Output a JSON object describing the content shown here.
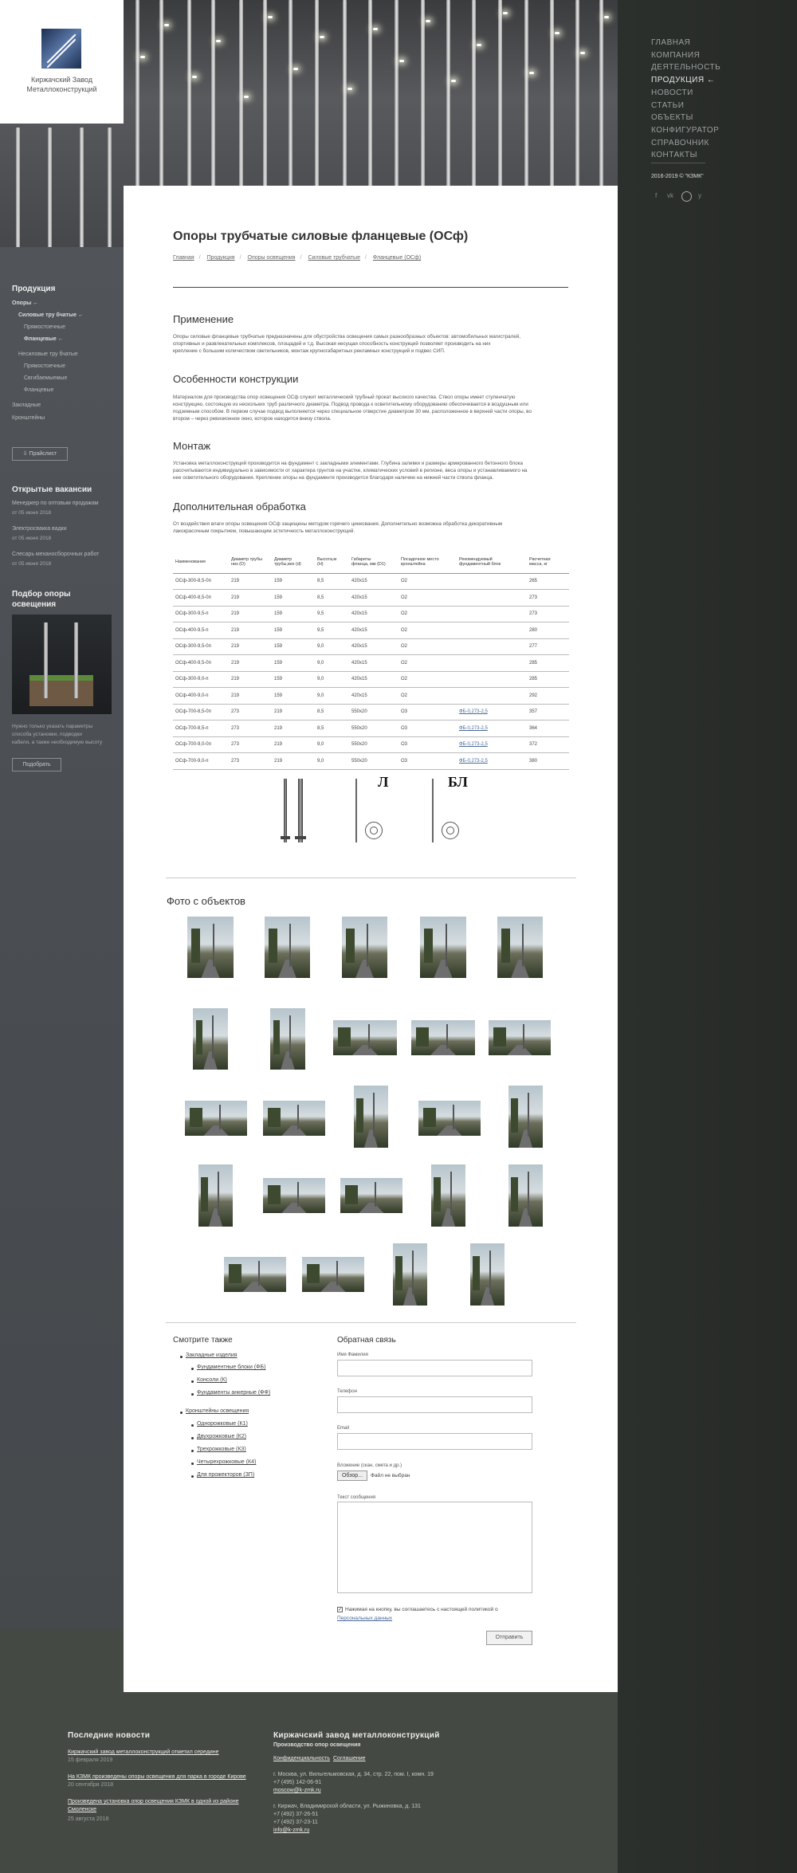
{
  "logo": {
    "line1": "Киржачский Завод",
    "line2": "Металлоконструкций"
  },
  "right_nav": {
    "items": [
      "ГЛАВНАЯ",
      "КОМПАНИЯ",
      "ДЕЯТЕЛЬНОСТЬ",
      "ПРОДУКЦИЯ ←",
      "НОВОСТИ",
      "СТАТЬИ",
      "ОБЪЕКТЫ",
      "КОНФИГУРАТОР",
      "СПРАВОЧНИК",
      "КОНТАКТЫ"
    ],
    "copyright": "2016-2019 © \"КЗМК\"",
    "social": [
      "f",
      "vk",
      "y"
    ]
  },
  "left_nav": {
    "heading": "Продукция",
    "items": [
      "Опоры  ←",
      "Силовые тру бчатые  ←",
      "Прямостоечные",
      "Фланцевые  ←",
      "Несиловые тру бчатые",
      "Прямостоечные",
      "Свгибаемыемые",
      "Фланцевые",
      "Закладные",
      "Кронштейны"
    ],
    "price_btn": "⇩ Прайслист"
  },
  "vacancies": {
    "heading": "Открытые вакансии",
    "items": [
      {
        "title": "Менеджер по оптовым продажам",
        "date": "от 05 июня 2018"
      },
      {
        "title": "Электросвакка вадки",
        "date": "от 05 июня 2018"
      },
      {
        "title": "Слесарь механосборочных работ",
        "date": "от 05 июня 2018"
      }
    ]
  },
  "picker": {
    "heading1": "Подбор опоры",
    "heading2": "освещения",
    "text": [
      "Нужно только указать параметры",
      "способа установки, подводки",
      "кабеля, а также необходимую высоту"
    ],
    "button": "Подобрать"
  },
  "main": {
    "title": "Опоры трубчатые силовые фланцевые (ОСф)",
    "breadcrumbs": [
      "Главная",
      "Продукция",
      "Опоры освещения",
      "Силовые трубчатые",
      "Фланцевые (ОСф)"
    ],
    "sections": [
      {
        "title": "Применение",
        "text": [
          "Опоры силовые фланцевые трубчатые предназначены для обустройства освещения самых разнообразных объектов: автомобильных магистралей,",
          "спортивных и развлекательных комплексов, площадей и т.д. Высокая несущая способность конструкций позволяет производить на них",
          "крепление с большим количеством светильников, монтаж крупногабаритных рекламных конструкций и подвес СИП."
        ]
      },
      {
        "title": "Особенности конструкции",
        "text": [
          "Материалом для производства опор освещения ОСф служит металлический трубный прокат высокого качества. Ствол опоры имеет ступенчатую",
          "конструкцию, состоящую из нескольких труб различного диаметра. Подвод провода к осветительному оборудованию обеспечивается в воздушным или",
          "подземным способом. В первом случае подвод выполняется через специальное отверстие диаметром 30 мм, расположенное в верхней части опоры, во",
          "втором – через ревизионное окно, которое находится внизу ствола."
        ]
      },
      {
        "title": "Монтаж",
        "text": [
          "Установка металлоконструкций производится на фундамент с закладными элементами. Глубина заливки и размеры армированного бетонного блока",
          "рассчитываются индивидуально в зависимости от характера грунтов на участке, климатических условий в регионе, веса опоры и устанавливаемого на",
          "нее осветительного оборудования. Крепление опоры на фундаменте производится благодаря наличию на нижней части ствола фланца."
        ]
      },
      {
        "title": "Дополнительная обработка",
        "text": [
          "От воздействия влаги опоры освещения ОСф защищены методом горячего цинкования. Дополнительно возможна обработка декоративным",
          "лакокрасочным покрытием, повышающим эстетичность металлоконструкций."
        ]
      }
    ],
    "table": {
      "headers": [
        [
          "Наименование"
        ],
        [
          "Диаметр трубы",
          "низ (D)"
        ],
        [
          "Диаметр",
          "трубы,вех (d)"
        ],
        [
          "Высота,м",
          "(H)"
        ],
        [
          "Габариты",
          "фланца, мм (D1)"
        ],
        [
          "Посадочное место",
          "кронштейна"
        ],
        [
          "Рекомендуемый",
          "фундаментный блок"
        ],
        [
          "Расчетная",
          "масса, кг"
        ]
      ],
      "rows": [
        [
          "ОСф-300-8,5-0п",
          "219",
          "159",
          "8,5",
          "420х15",
          "О2",
          "",
          "265"
        ],
        [
          "ОСф-400-8,5-0п",
          "219",
          "159",
          "8,5",
          "420х15",
          "О2",
          "",
          "273"
        ],
        [
          "ОСф-300-9,5-п",
          "219",
          "159",
          "9,5",
          "420х15",
          "О2",
          "",
          "273"
        ],
        [
          "ОСф-400-9,5-п",
          "219",
          "159",
          "9,5",
          "420х15",
          "О2",
          "",
          "280"
        ],
        [
          "ОСф-300-9,5-0п",
          "219",
          "159",
          "9,0",
          "420х15",
          "О2",
          "",
          "277"
        ],
        [
          "ОСф-400-9,5-0п",
          "219",
          "159",
          "9,0",
          "420х15",
          "О2",
          "",
          "285"
        ],
        [
          "ОСф-300-9,0-п",
          "219",
          "159",
          "9,0",
          "420х15",
          "О2",
          "",
          "285"
        ],
        [
          "ОСф-400-9,0-п",
          "219",
          "159",
          "9,0",
          "420х15",
          "О2",
          "",
          "292"
        ],
        [
          "ОСф-700-8,5-0п",
          "273",
          "219",
          "8,5",
          "550х20",
          "О3",
          "ФБ-0,273-2,5",
          "357"
        ],
        [
          "ОСф-700-8,5-п",
          "273",
          "219",
          "8,5",
          "550х20",
          "О3",
          "ФБ-0,273-2,5",
          "364"
        ],
        [
          "ОСф-700-9,0-0п",
          "273",
          "219",
          "9,0",
          "550х20",
          "О3",
          "ФБ-0,273-2,5",
          "372"
        ],
        [
          "ОСф-700-9,0-п",
          "273",
          "219",
          "9,0",
          "550х20",
          "О3",
          "ФБ-0,273-2,5",
          "380"
        ]
      ]
    },
    "drawing_letters": [
      "Л",
      "БЛ"
    ],
    "photos_title": "Фото с объектов"
  },
  "see_also": {
    "title": "Смотрите также",
    "groups": [
      {
        "name": "Закладные изделия",
        "items": [
          "Фундаментные блоки (ФБ)",
          "Консоли (К)",
          "Фундаменты анкерные (ФФ)"
        ]
      },
      {
        "name": "Кронштейны освещения",
        "items": [
          "Однорожковые (К1)",
          "Двухрожковые (К2)",
          "Трехрожковые (К3)",
          "Четырехрожковые (К4)",
          "Для прожекторов (ЗП)"
        ]
      }
    ]
  },
  "feedback": {
    "title": "Обратная связь",
    "name_label": "Имя Фамилия",
    "phone_label": "Телефон",
    "email_label": "Email",
    "file_label": "Вложение (скан, смета и др.)",
    "file_btn": "Обзор...",
    "file_status": "Файл не выбран",
    "message_label": "Текст сообщения",
    "consent": "Нажимая на кнопку, вы соглашаетесь с настоящей политикой о",
    "consent_link": "Персональных данных",
    "submit": "Отправить"
  },
  "footer": {
    "news_title": "Последние новости",
    "news": [
      {
        "title": "Киржачский завод металлоконструкций отметил середине",
        "date": "15 февраля 2019"
      },
      {
        "title": "На КЗМК произведены опоры освещения для парка в городе Кирове",
        "date": "20 сентября 2018"
      },
      {
        "title": "Произведена установка опор освещения КЗМК в одной из районе",
        "title2": "Смоленске",
        "date": "25 августа 2018"
      }
    ],
    "company_title": "Киржачский завод металлоконструкций",
    "company_sub": "Производство опор освещения",
    "links": [
      "Конфиденциальность",
      "Соглашение"
    ],
    "addr1": [
      "г. Москва, ул. Вильгельмовская, д. 34, стр. 22, пом. I, комн. 19",
      "+7 (495) 142-06-91",
      "moscow@k-zmk.ru"
    ],
    "addr2": [
      "г. Киржач, Владимирской области, ул. Рыжиновка, д. 131",
      "+7 (492) 37-26-51",
      "+7 (492) 37-23-11",
      "info@k-zmk.ru"
    ]
  }
}
